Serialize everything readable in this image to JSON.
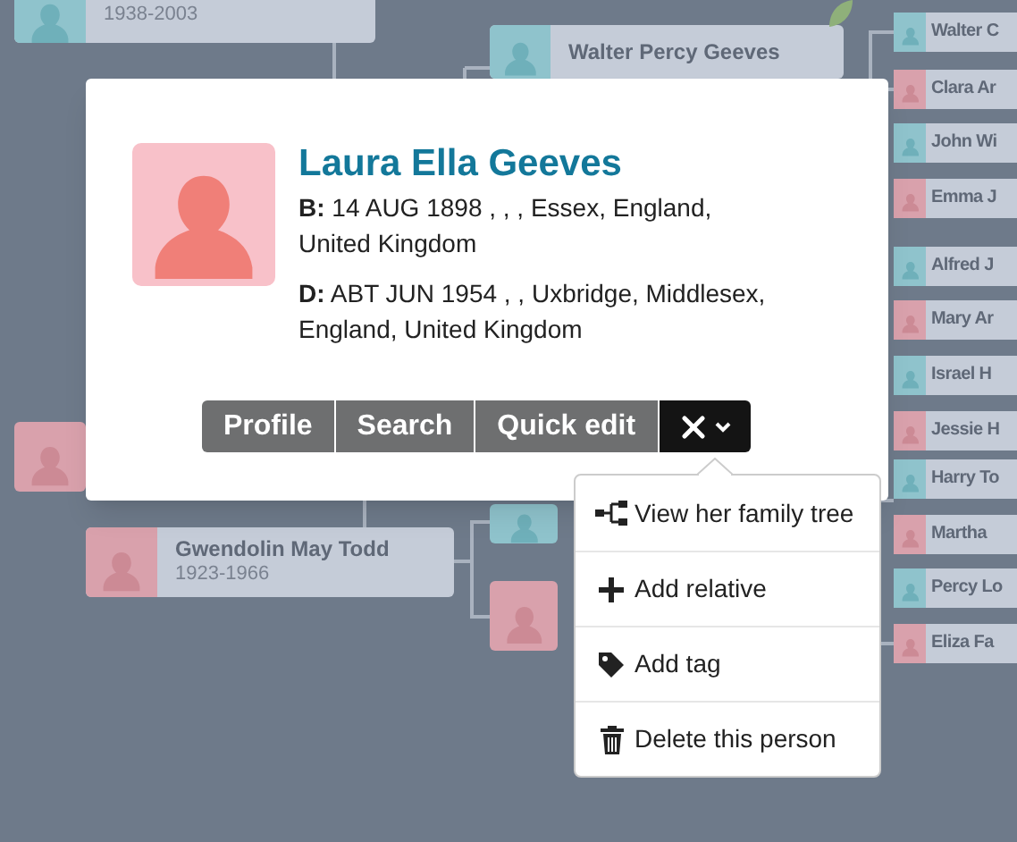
{
  "tree": {
    "cards": [
      {
        "dates": "1938-2003",
        "kind": "male"
      },
      {
        "name": "Walter Percy Geeves",
        "kind": "male"
      },
      {
        "name": "Gwendolin May Todd",
        "dates": "1923-1966",
        "kind": "female"
      }
    ],
    "ancestors": [
      {
        "name": "Walter C",
        "kind": "male"
      },
      {
        "name": "Clara Ar",
        "kind": "female"
      },
      {
        "name": "John Wi",
        "kind": "male"
      },
      {
        "name": "Emma J",
        "kind": "female"
      },
      {
        "name": "Alfred J",
        "kind": "male"
      },
      {
        "name": "Mary Ar",
        "kind": "female"
      },
      {
        "name": "Israel H",
        "kind": "male"
      },
      {
        "name": "Jessie H",
        "kind": "female"
      },
      {
        "name": "Harry To",
        "kind": "male"
      },
      {
        "name": "Martha",
        "kind": "female"
      },
      {
        "name": "Percy Lo",
        "kind": "male"
      },
      {
        "name": "Eliza Fa",
        "kind": "female"
      }
    ]
  },
  "popup": {
    "name": "Laura Ella Geeves",
    "kind": "female",
    "birth": {
      "label": "B:",
      "text": "14 AUG 1898 , , , Essex, England, United Kingdom"
    },
    "death": {
      "label": "D:",
      "text": "ABT JUN 1954 , , Uxbridge, Middlesex, England, United Kingdom"
    },
    "buttons": [
      "Profile",
      "Search",
      "Quick edit"
    ],
    "menu": [
      "View her family tree",
      "Add relative",
      "Add tag",
      "Delete this person"
    ]
  }
}
